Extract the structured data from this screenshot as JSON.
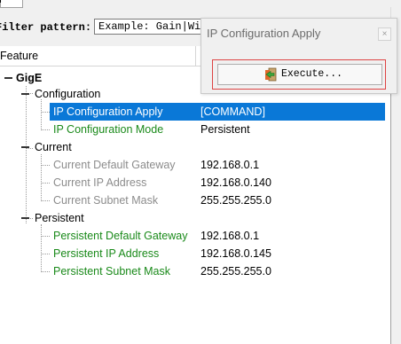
{
  "filter": {
    "label": "Filter pattern:",
    "placeholder": "Example: Gain|Width"
  },
  "header": {
    "feature_label": "Feature"
  },
  "tree": {
    "root": "GigE",
    "groups": [
      {
        "name": "Configuration",
        "items": [
          {
            "label": "IP Configuration Apply",
            "value": "[COMMAND]"
          },
          {
            "label": "IP Configuration Mode",
            "value": "Persistent"
          }
        ]
      },
      {
        "name": "Current",
        "items": [
          {
            "label": "Current Default Gateway",
            "value": "192.168.0.1"
          },
          {
            "label": "Current IP Address",
            "value": "192.168.0.140"
          },
          {
            "label": "Current Subnet Mask",
            "value": "255.255.255.0"
          }
        ]
      },
      {
        "name": "Persistent",
        "items": [
          {
            "label": "Persistent Default Gateway",
            "value": "192.168.0.1"
          },
          {
            "label": "Persistent IP Address",
            "value": "192.168.0.145"
          },
          {
            "label": "Persistent Subnet Mask",
            "value": "255.255.255.0"
          }
        ]
      }
    ]
  },
  "popup": {
    "title": "IP Configuration Apply",
    "close_symbol": "×",
    "execute_label": "Execute..."
  },
  "colors": {
    "selection": "#0a78d7",
    "editable_text": "#1a8a1a",
    "readonly_text": "#8c8c8c",
    "highlight_frame": "#dd4444"
  }
}
